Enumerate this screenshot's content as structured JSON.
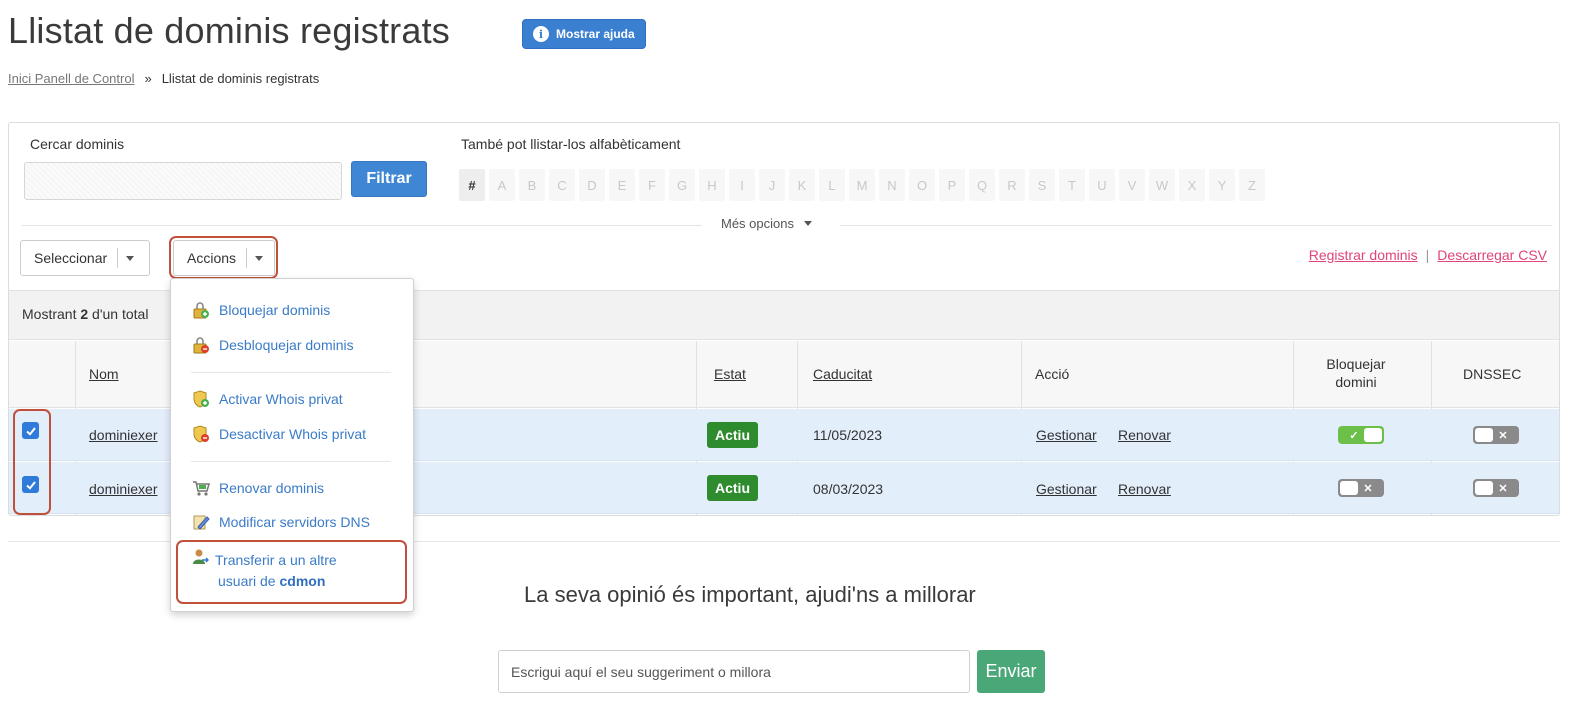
{
  "header": {
    "title": "Llistat de dominis registrats",
    "help_label": "Mostrar ajuda"
  },
  "breadcrumb": {
    "home": "Inici Panell de Control",
    "separator": "»",
    "current": "Llistat de dominis registrats"
  },
  "search": {
    "label": "Cercar dominis",
    "value": "",
    "filter_label": "Filtrar",
    "alpha_label": "També pot llistar-los alfabèticament",
    "letters": [
      "#",
      "A",
      "B",
      "C",
      "D",
      "E",
      "F",
      "G",
      "H",
      "I",
      "J",
      "K",
      "L",
      "M",
      "N",
      "O",
      "P",
      "Q",
      "R",
      "S",
      "T",
      "U",
      "V",
      "W",
      "X",
      "Y",
      "Z"
    ],
    "more_options": "Més opcions"
  },
  "toolbar": {
    "select_label": "Seleccionar",
    "actions_label": "Accions",
    "register_link": "Registrar dominis",
    "link_separator": "|",
    "csv_link": "Descarregar CSV"
  },
  "summary": {
    "prefix": "Mostrant",
    "count": "2",
    "suffix": "d'un total"
  },
  "table": {
    "headers": {
      "name": "Nom",
      "status": "Estat",
      "expiry": "Caducitat",
      "action": "Acció",
      "lock": "Bloquejar domini",
      "dnssec": "DNSSEC"
    },
    "rows": [
      {
        "checked": true,
        "name": "dominiexer",
        "status": "Actiu",
        "expiry": "11/05/2023",
        "manage": "Gestionar",
        "renew": "Renovar",
        "lock_on": true,
        "dnssec_on": false
      },
      {
        "checked": true,
        "name": "dominiexer",
        "status": "Actiu",
        "expiry": "08/03/2023",
        "manage": "Gestionar",
        "renew": "Renovar",
        "lock_on": false,
        "dnssec_on": false
      }
    ]
  },
  "actions_menu": {
    "items": [
      {
        "label": "Bloquejar dominis",
        "icon": "lock-add-icon"
      },
      {
        "label": "Desbloquejar dominis",
        "icon": "lock-remove-icon"
      },
      {
        "label": "Activar Whois privat",
        "icon": "shield-add-icon"
      },
      {
        "label": "Desactivar Whois privat",
        "icon": "shield-remove-icon"
      },
      {
        "label": "Renovar dominis",
        "icon": "cart-icon"
      },
      {
        "label": "Modificar servidors DNS",
        "icon": "edit-icon"
      }
    ],
    "transfer": {
      "line1": "Transferir a un altre",
      "line2_prefix": "usuari de",
      "line2_brand": "cdmon",
      "icon": "user-transfer-icon"
    }
  },
  "feedback": {
    "title": "La seva opinió és important, ajudi'ns a millorar",
    "placeholder": "Escrigui aquí el seu suggeriment o millora",
    "send_label": "Enviar"
  },
  "colors": {
    "primary": "#3b7fd1",
    "highlight": "#c0503a",
    "active_badge": "#2e8b2e",
    "link_pink": "#e0457b",
    "send": "#4aa878",
    "row_selected": "#e3eefb"
  }
}
